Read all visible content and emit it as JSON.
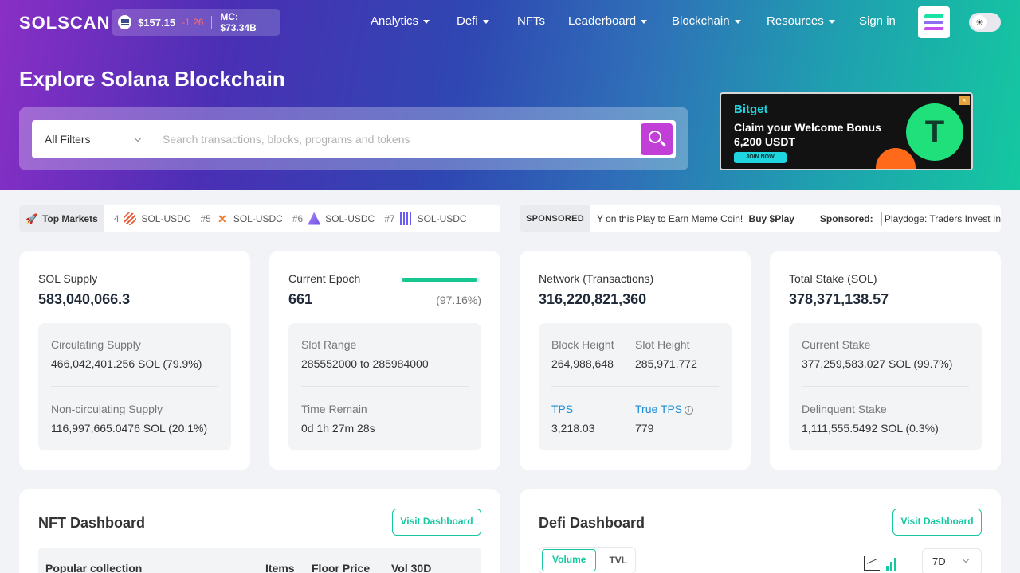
{
  "header": {
    "logo": "SOLSCAN",
    "sol_price": "$157.15",
    "sol_change": "-1.26",
    "market_cap": "MC: $73.34B",
    "nav": [
      {
        "label": "Analytics",
        "dropdown": true
      },
      {
        "label": "Defi",
        "dropdown": true
      },
      {
        "label": "NFTs",
        "dropdown": false
      },
      {
        "label": "Leaderboard",
        "dropdown": true
      },
      {
        "label": "Blockchain",
        "dropdown": true
      },
      {
        "label": "Resources",
        "dropdown": true
      },
      {
        "label": "Sign in",
        "dropdown": false
      }
    ],
    "icons": {
      "apps": "solana-logo-icon",
      "theme": "sun-icon"
    }
  },
  "hero": {
    "title": "Explore Solana Blockchain",
    "filter_label": "All Filters",
    "search_placeholder": "Search transactions, blocks, programs and tokens"
  },
  "ad": {
    "brand": "Bitget",
    "line1": "Claim your Welcome Bonus",
    "line2": "6,200 USDT",
    "cta": "JOIN NOW",
    "coin_symbol": "T"
  },
  "top_markets": {
    "label": "Top Markets",
    "items": [
      {
        "rank": "4",
        "pair": "SOL-USDC",
        "color": "#e8603c"
      },
      {
        "rank": "#5",
        "pair": "SOL-USDC",
        "color": "#f07a28"
      },
      {
        "rank": "#6",
        "pair": "SOL-USDC",
        "color": "#8e6bf0"
      },
      {
        "rank": "#7",
        "pair": "SOL-USDC",
        "color": "#6a5cf0"
      }
    ]
  },
  "sponsored": {
    "label": "SPONSORED",
    "text": "Y on this Play to Earn Meme Coin!",
    "cta": "Buy $Play",
    "label2": "Sponsored:",
    "text2": "Playdoge: Traders Invest In"
  },
  "cards": {
    "supply": {
      "title": "SOL Supply",
      "value": "583,040,066.3",
      "circ_label": "Circulating Supply",
      "circ_value": "466,042,401.256 SOL (79.9%)",
      "noncirc_label": "Non-circulating Supply",
      "noncirc_value": "116,997,665.0476 SOL (20.1%)"
    },
    "epoch": {
      "title": "Current Epoch",
      "value": "661",
      "progress_pct": "(97.16%)",
      "progress": 0.9716,
      "slot_range_label": "Slot Range",
      "slot_range_value": "285552000 to 285984000",
      "time_remain_label": "Time Remain",
      "time_remain_value": "0d 1h 27m 28s"
    },
    "network": {
      "title": "Network (Transactions)",
      "value": "316,220,821,360",
      "block_height_label": "Block Height",
      "block_height_value": "264,988,648",
      "slot_height_label": "Slot Height",
      "slot_height_value": "285,971,772",
      "tps_label": "TPS",
      "tps_value": "3,218.03",
      "true_tps_label": "True TPS",
      "true_tps_value": "779"
    },
    "stake": {
      "title": "Total Stake (SOL)",
      "value": "378,371,138.57",
      "current_label": "Current Stake",
      "current_value": "377,259,583.027 SOL (99.7%)",
      "delinquent_label": "Delinquent Stake",
      "delinquent_value": "1,111,555.5492 SOL (0.3%)"
    }
  },
  "nft_dashboard": {
    "title": "NFT Dashboard",
    "button": "Visit Dashboard",
    "columns": [
      "Popular collection",
      "Items",
      "Floor Price",
      "Vol 30D"
    ]
  },
  "defi_dashboard": {
    "title": "Defi Dashboard",
    "button": "Visit Dashboard",
    "tabs": [
      "Volume",
      "TVL"
    ],
    "range": "7D"
  },
  "colors": {
    "accent": "#14c8a0",
    "search_button": "#c13fd7",
    "link": "#1b8cd6",
    "negative": "#ff6b6b"
  }
}
